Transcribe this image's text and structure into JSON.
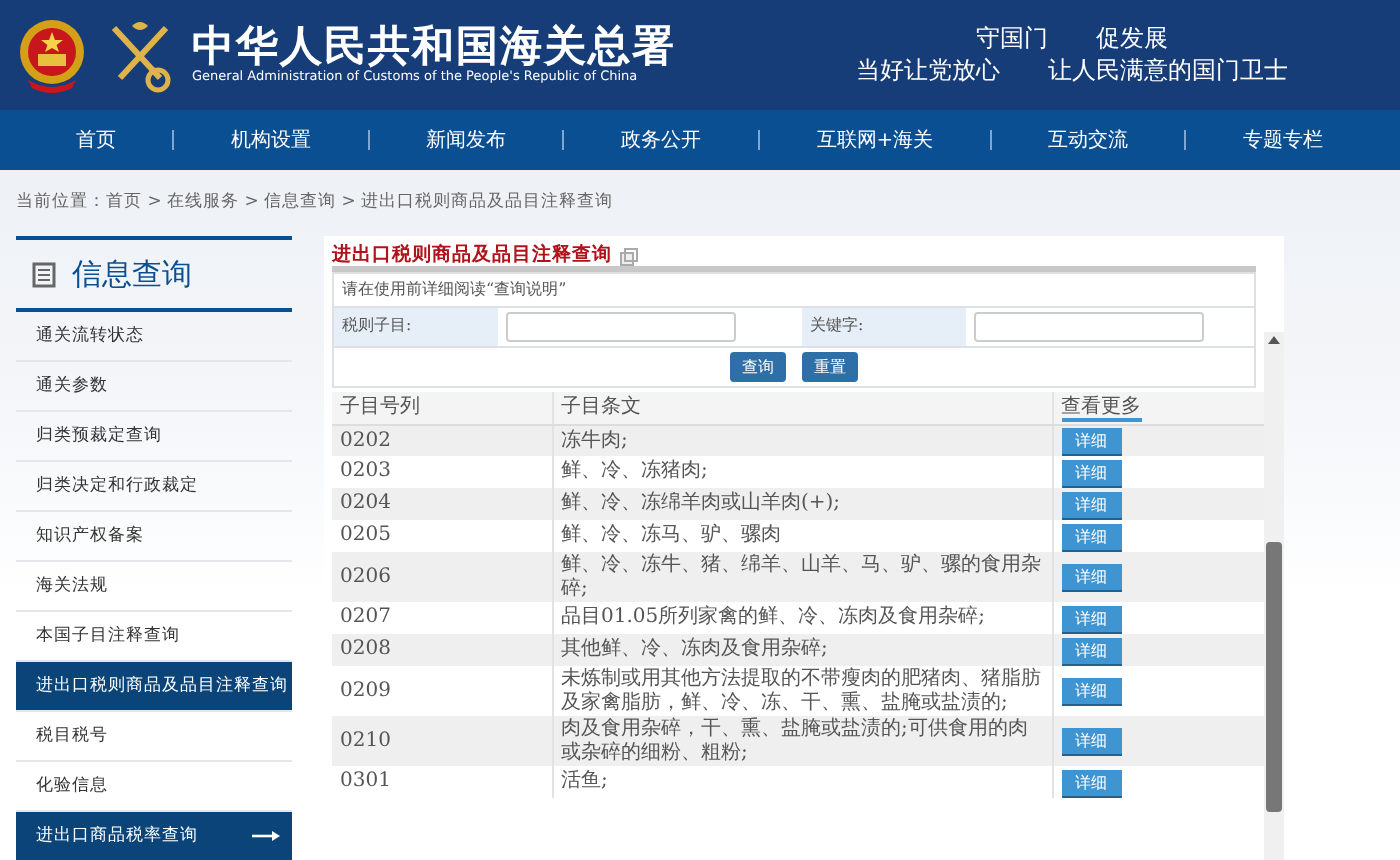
{
  "header": {
    "title": "中华人民共和国海关总署",
    "subtitle": "General Administration of Customs of the People's Republic of China",
    "slogans": [
      [
        "守国门",
        "促发展"
      ],
      [
        "当好让党放心",
        "让人民满意的国门卫士"
      ]
    ]
  },
  "nav": [
    "首页",
    "机构设置",
    "新闻发布",
    "政务公开",
    "互联网+海关",
    "互动交流",
    "专题专栏"
  ],
  "breadcrumb": "当前位置：首页 > 在线服务 > 信息查询 > 进出口税则商品及品目注释查询",
  "sidebar": {
    "title": "信息查询",
    "items": [
      {
        "label": "通关流转状态",
        "selected": false,
        "kind": "item"
      },
      {
        "label": "通关参数",
        "selected": false,
        "kind": "item"
      },
      {
        "label": "归类预裁定查询",
        "selected": false,
        "kind": "item"
      },
      {
        "label": "归类决定和行政裁定",
        "selected": false,
        "kind": "item"
      },
      {
        "label": "知识产权备案",
        "selected": false,
        "kind": "item"
      },
      {
        "label": "海关法规",
        "selected": false,
        "kind": "item"
      },
      {
        "label": "本国子目注释查询",
        "selected": false,
        "kind": "item"
      },
      {
        "label": "进出口税则商品及品目注释查询",
        "selected": true,
        "kind": "item"
      },
      {
        "label": "税目税号",
        "selected": false,
        "kind": "item"
      },
      {
        "label": "化验信息",
        "selected": false,
        "kind": "item"
      },
      {
        "label": "进出口商品税率查询",
        "kind": "link"
      }
    ]
  },
  "query": {
    "title": "进出口税则商品及品目注释查询",
    "notice": "请在使用前详细阅读“查询说明”",
    "fields": [
      {
        "label": "税则子目:"
      },
      {
        "label": "关键字:"
      }
    ],
    "buttons": [
      "查询",
      "重置"
    ],
    "table": {
      "columns": [
        "子目号列",
        "子目条文",
        "查看更多"
      ],
      "rows": [
        {
          "code": "0202",
          "text": "冻牛肉;",
          "action": "详细"
        },
        {
          "code": "0203",
          "text": "鲜、冷、冻猪肉;",
          "action": "详细"
        },
        {
          "code": "0204",
          "text": "鲜、冷、冻绵羊肉或山羊肉(+);",
          "action": "详细"
        },
        {
          "code": "0205",
          "text": "鲜、冷、冻马、驴、骡肉",
          "action": "详细"
        },
        {
          "code": "0206",
          "text": "鲜、冷、冻牛、猪、绵羊、山羊、马、驴、骡的食用杂碎;",
          "action": "详细"
        },
        {
          "code": "0207",
          "text": "品目01.05所列家禽的鲜、冷、冻肉及食用杂碎;",
          "action": "详细"
        },
        {
          "code": "0208",
          "text": "其他鲜、冷、冻肉及食用杂碎;",
          "action": "详细"
        },
        {
          "code": "0209",
          "text": "未炼制或用其他方法提取的不带瘦肉的肥猪肉、猪脂肪及家禽脂肪，鲜、冷、冻、干、熏、盐腌或盐渍的;",
          "action": "详细"
        },
        {
          "code": "0210",
          "text": "肉及食用杂碎，干、熏、盐腌或盐渍的;可供食用的肉或杂碎的细粉、粗粉;",
          "action": "详细"
        },
        {
          "code": "0301",
          "text": "活鱼;",
          "action": "详细"
        }
      ]
    }
  }
}
